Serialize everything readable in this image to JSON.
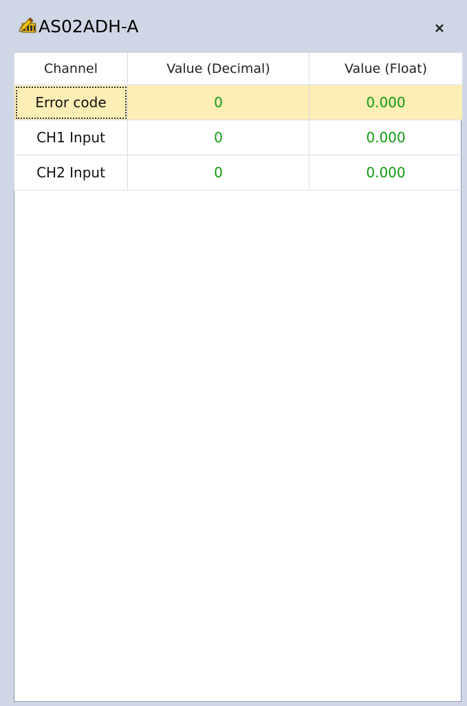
{
  "window": {
    "title": "AS02ADH-A",
    "icon": "module-edit-icon",
    "close_label": "×"
  },
  "table": {
    "columns": [
      "Channel",
      "Value (Decimal)",
      "Value (Float)"
    ],
    "rows": [
      {
        "channel": "Error code",
        "decimal": "0",
        "float": "0.000",
        "selected": true
      },
      {
        "channel": "CH1 Input",
        "decimal": "0",
        "float": "0.000",
        "selected": false
      },
      {
        "channel": "CH2 Input",
        "decimal": "0",
        "float": "0.000",
        "selected": false
      }
    ]
  },
  "colors": {
    "window_bg": "#cfd6e5",
    "selected_row": "#fdeeb5",
    "value_text": "#119911"
  }
}
